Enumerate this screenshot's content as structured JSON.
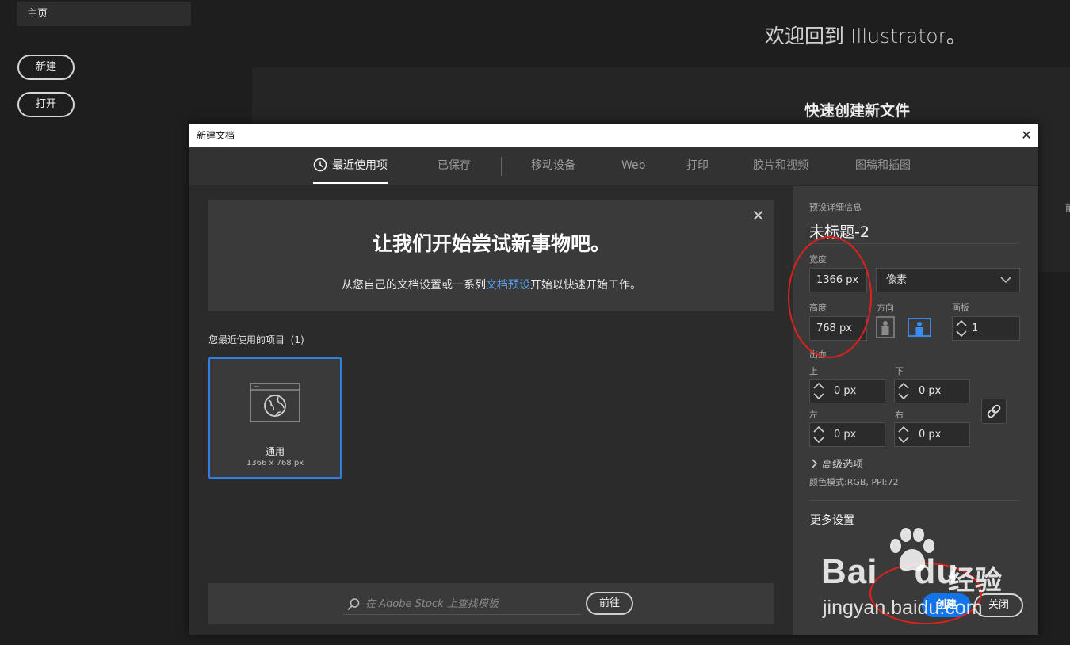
{
  "home": {
    "tab_label": "主页",
    "new_label": "新建",
    "open_label": "打开",
    "welcome": "欢迎回到 Illustrator。",
    "quick_create": "快速创建新文件"
  },
  "dialog": {
    "title": "新建文档",
    "close_glyph": "✕",
    "tabs": [
      {
        "label": "最近使用项",
        "active": true
      },
      {
        "label": "已保存"
      },
      {
        "label": "移动设备"
      },
      {
        "label": "Web"
      },
      {
        "label": "打印"
      },
      {
        "label": "胶片和视频"
      },
      {
        "label": "图稿和插图"
      }
    ],
    "banner": {
      "title": "让我们开始尝试新事物吧。",
      "sub_before": "从您自己的文档设置或一系列",
      "sub_link": "文档预设",
      "sub_after": "开始以快速开始工作。",
      "close_glyph": "✕"
    },
    "recent": {
      "label": "您最近使用的项目",
      "count": "(1)",
      "items": [
        {
          "name": "通用",
          "size": "1366 x 768 px"
        }
      ]
    },
    "stock": {
      "placeholder": "在 Adobe Stock 上查找模板",
      "go_label": "前往"
    },
    "details": {
      "heading": "预设详细信息",
      "name": "未标题-2",
      "width_label": "宽度",
      "width_value": "1366 px",
      "unit": "像素",
      "height_label": "高度",
      "height_value": "768 px",
      "orientation_label": "方向",
      "artboards_label": "画板",
      "artboards_value": "1",
      "bleed_label": "出血",
      "top_label": "上",
      "top_value": "0 px",
      "bottom_label": "下",
      "bottom_value": "0 px",
      "left_label": "左",
      "left_value": "0 px",
      "right_label": "右",
      "right_value": "0 px",
      "advanced_label": "高级选项",
      "color_mode": "颜色模式:RGB, PPI:72",
      "more_settings": "更多设置",
      "create_label": "创建",
      "close_label": "关闭"
    }
  },
  "watermark": {
    "brand": "Bai",
    "brand_tail": "du",
    "jingyan": "经验",
    "url": "jingyan.baidu.com"
  },
  "colors": {
    "accent": "#1473e6",
    "link": "#5aa0f0",
    "annotation": "#e0201a"
  }
}
